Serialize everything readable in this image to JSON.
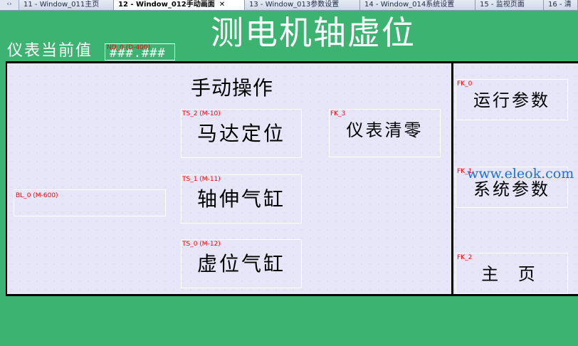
{
  "tabs": [
    {
      "label": "11 - Window_011主页",
      "active": false
    },
    {
      "label": "12 - Window_012手动画面",
      "active": true
    },
    {
      "label": "13 - Window_013参数设置",
      "active": false
    },
    {
      "label": "14 - Window_014系统设置",
      "active": false
    },
    {
      "label": "15 - 监视页面",
      "active": false
    },
    {
      "label": "16 - 清",
      "active": false
    }
  ],
  "tab_close": "✕",
  "tab_scroll_icon": "‹›",
  "header": {
    "title": "测电机轴虚位",
    "meter_label": "仪表当前值",
    "meter_tag": "ND_0 (D-400)",
    "meter_value": "###.###"
  },
  "main": {
    "section_title": "手动操作",
    "bl_tag": "BL_0 (M-600)",
    "buttons": [
      {
        "tag": "TS_2 (M-10)",
        "label": "马达定位"
      },
      {
        "tag": "TS_1 (M-11)",
        "label": "轴伸气缸"
      },
      {
        "tag": "TS_0 (M-12)",
        "label": "虚位气缸"
      },
      {
        "tag": "FK_3",
        "label": "仪表清零"
      }
    ]
  },
  "sidebar": {
    "buttons": [
      {
        "tag": "FK_0",
        "label": "运行参数"
      },
      {
        "tag": "FK_1",
        "label": "系统参数"
      },
      {
        "tag": "FK_2",
        "label": "主 页"
      }
    ]
  },
  "watermark": "www.eleok.com",
  "colors": {
    "background": "#3cb371",
    "panel": "#e6e6f8",
    "tag": "#ff0000"
  }
}
